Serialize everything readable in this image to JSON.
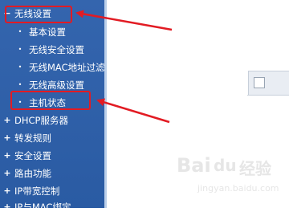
{
  "menu": [
    {
      "label": "无线设置",
      "icon": "minus",
      "level": "top",
      "highlighted": true
    },
    {
      "label": "基本设置",
      "icon": "bullet",
      "level": "sub"
    },
    {
      "label": "无线安全设置",
      "icon": "bullet",
      "level": "sub"
    },
    {
      "label": "无线MAC地址过滤",
      "icon": "bullet",
      "level": "sub"
    },
    {
      "label": "无线高级设置",
      "icon": "bullet",
      "level": "sub"
    },
    {
      "label": "主机状态",
      "icon": "bullet",
      "level": "sub",
      "highlighted": true
    },
    {
      "label": "DHCP服务器",
      "icon": "plus",
      "level": "top"
    },
    {
      "label": "转发规则",
      "icon": "plus",
      "level": "top"
    },
    {
      "label": "安全设置",
      "icon": "plus",
      "level": "top"
    },
    {
      "label": "路由功能",
      "icon": "plus",
      "level": "top"
    },
    {
      "label": "IP带宽控制",
      "icon": "plus",
      "level": "top"
    },
    {
      "label": "IP与MAC绑定",
      "icon": "plus",
      "level": "top"
    }
  ],
  "icons": {
    "minus": "−",
    "plus": "+",
    "bullet": "•"
  },
  "colors": {
    "sidebar": "#2d5fa8",
    "menu_text": "#ffffff",
    "annotation": "#e21b23"
  },
  "watermark": {
    "brand": "Bai",
    "paw": "du",
    "suffix": "经验",
    "url": "jingyan.baidu.com"
  }
}
